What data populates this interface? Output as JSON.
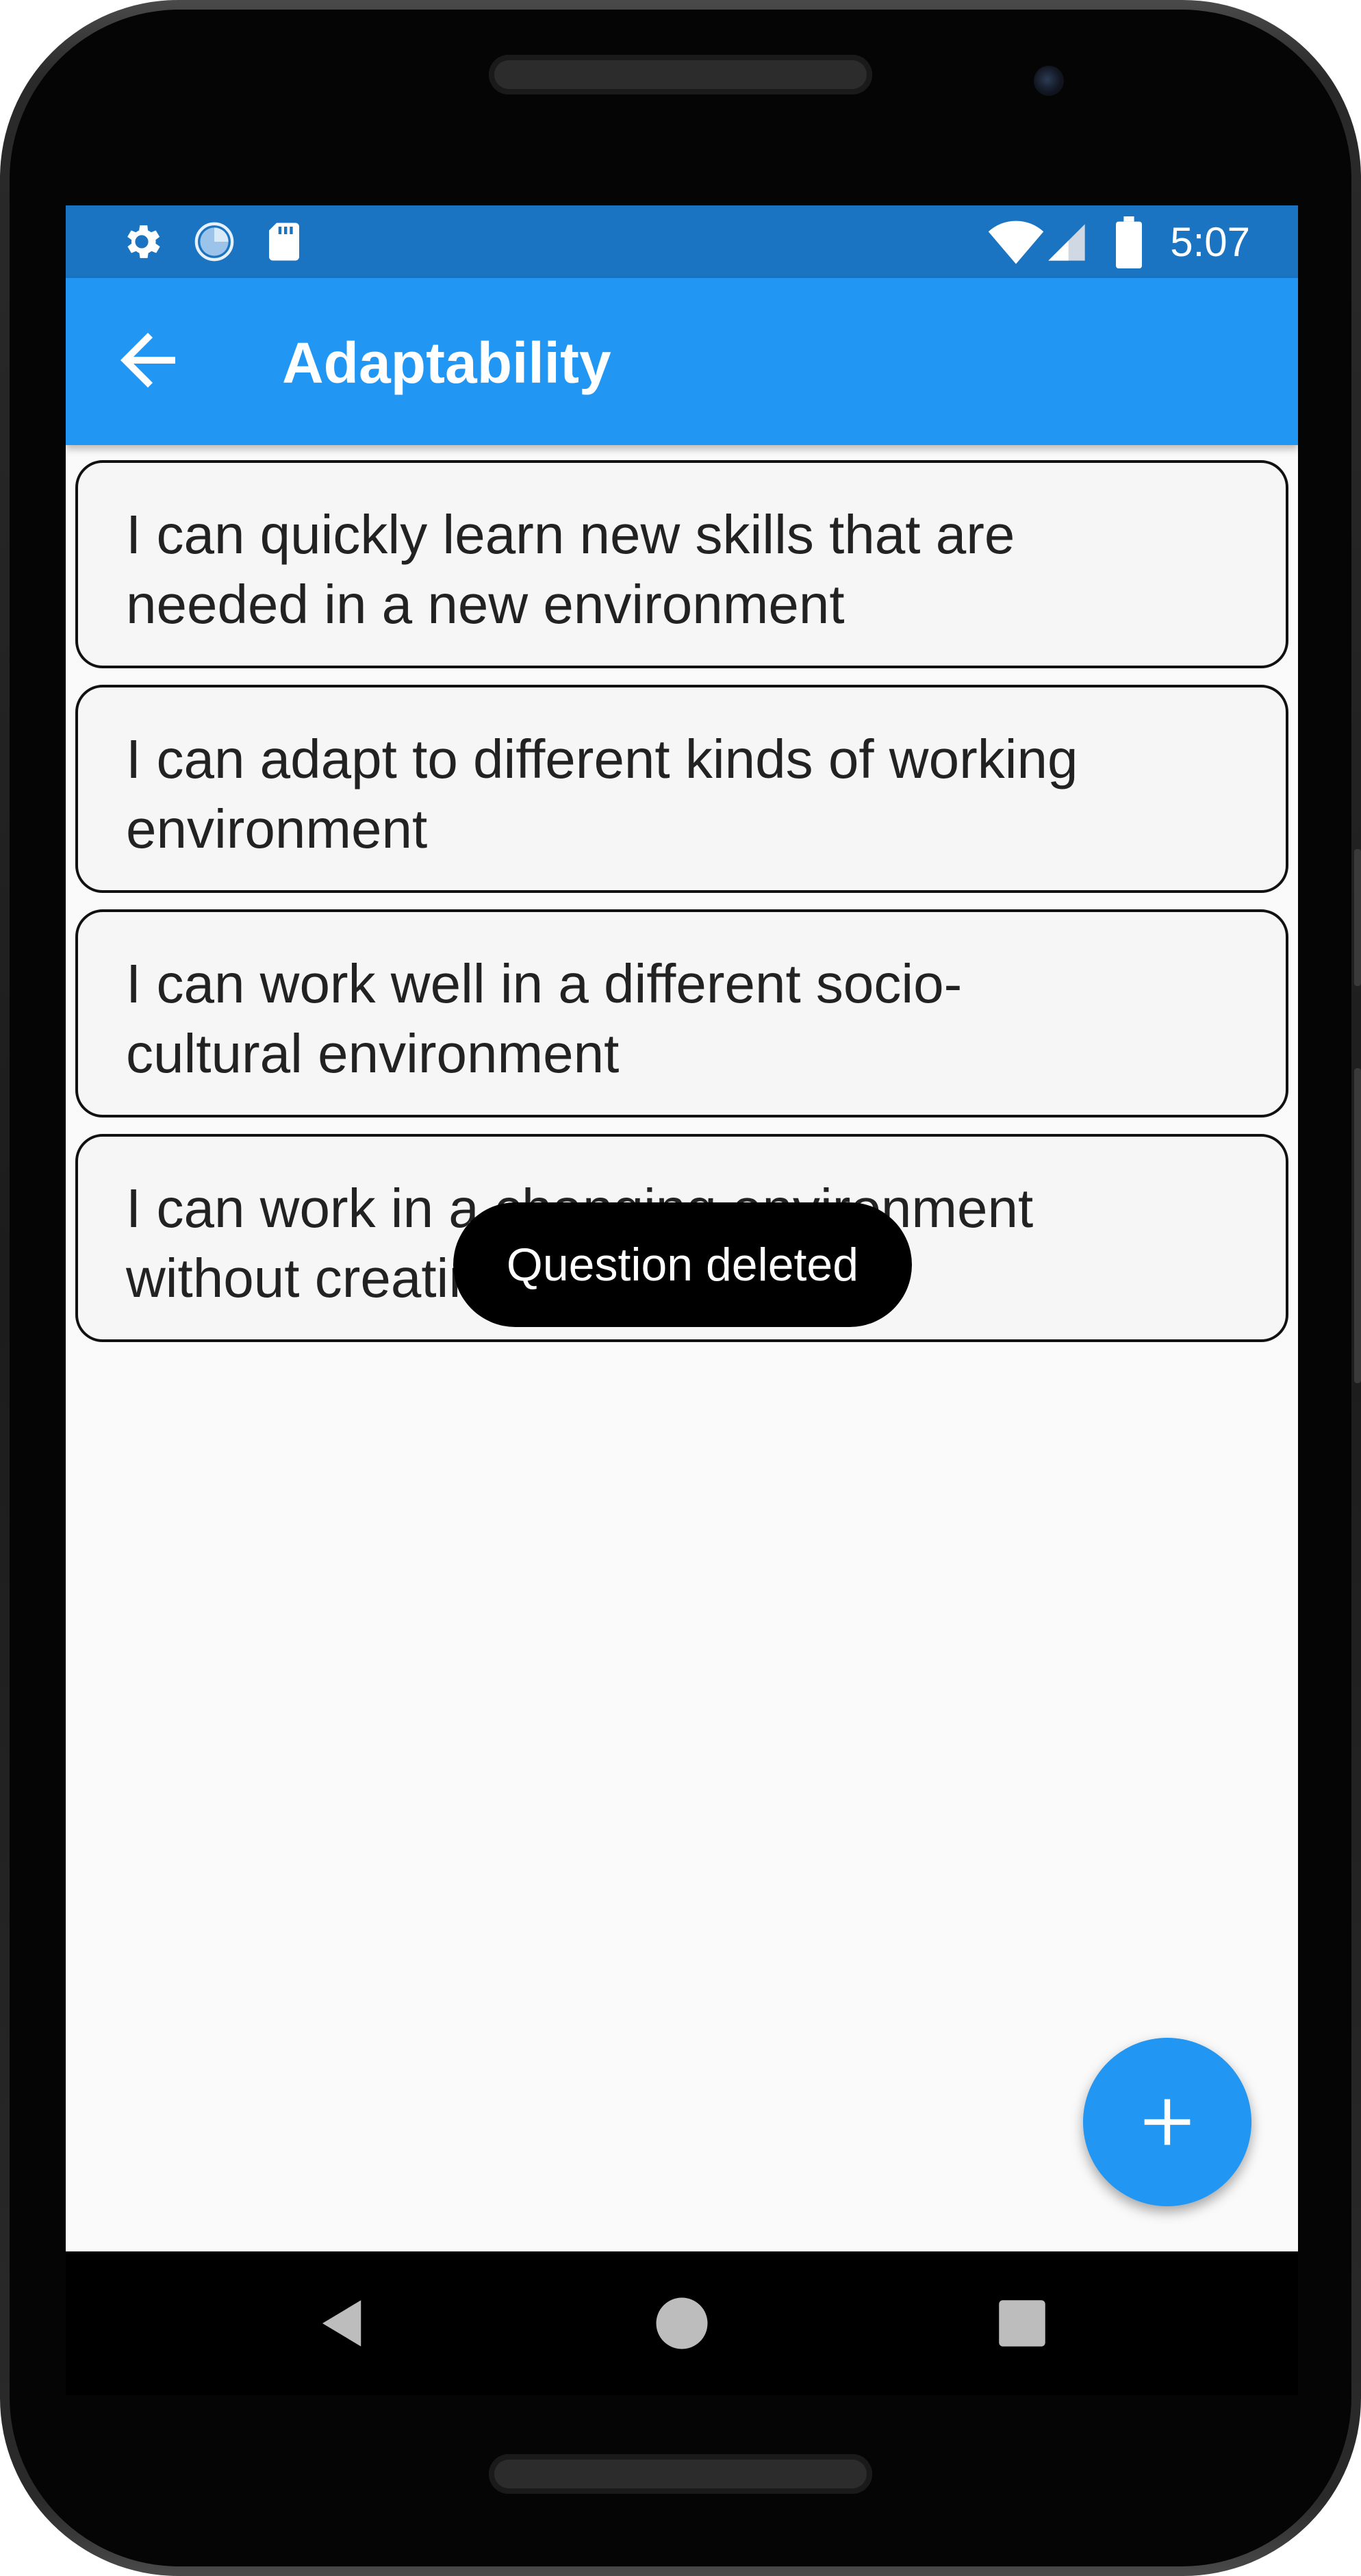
{
  "status_bar": {
    "time": "5:07",
    "left_icons": [
      "gear-icon",
      "sync-circle-icon",
      "sd-card-icon"
    ],
    "right_icons": [
      "wifi-icon",
      "cellular-signal-icon",
      "battery-icon"
    ]
  },
  "app_bar": {
    "title": "Adaptability",
    "back_icon": "arrow-back-icon"
  },
  "questions": [
    {
      "line1": "I can quickly learn new skills that are",
      "line2": "needed in a new environment"
    },
    {
      "line1": "I can adapt to different kinds of working",
      "line2": "environment"
    },
    {
      "line1": "I can work well in a different socio-",
      "line2": "cultural environment"
    },
    {
      "line1": "I can work in a changing environment",
      "line2": "without creating stress"
    }
  ],
  "toast": {
    "message": "Question deleted"
  },
  "fab": {
    "icon": "plus-icon"
  },
  "nav_bar": {
    "icons": [
      "back-triangle-icon",
      "home-circle-icon",
      "recents-square-icon"
    ]
  },
  "colors": {
    "status_bar": "#1b74c2",
    "app_bar": "#2196f3",
    "fab": "#2196f3",
    "screen_background": "#fafafa",
    "toast": "#000000"
  }
}
